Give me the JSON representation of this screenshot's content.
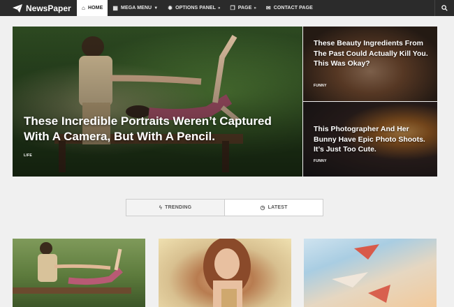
{
  "nav": {
    "brand": "NewsPaper",
    "items": [
      {
        "label": "HOME",
        "icon": "home-icon"
      },
      {
        "label": "MEGA MENU",
        "icon": "grid-icon"
      },
      {
        "label": "OPTIONS PANEL",
        "icon": "gear-icon"
      },
      {
        "label": "PAGE",
        "icon": "copy-icon"
      },
      {
        "label": "CONTACT PAGE",
        "icon": "mail-icon"
      }
    ],
    "search_icon": "search-icon"
  },
  "hero": {
    "main": {
      "title": "These Incredible Portraits Weren’t Captured With A Camera, But With A Pencil.",
      "category": "LIFE"
    },
    "side": [
      {
        "title": "These Beauty Ingredients From The Past Could Actually Kill You. This Was Okay?",
        "category": "FUNNY"
      },
      {
        "title": "This Photographer And Her Bunny Have Epic Photo Shoots. It’s Just Too Cute.",
        "category": "FUNNY"
      }
    ]
  },
  "tabs": [
    {
      "label": "TRENDING",
      "icon": "bolt-icon"
    },
    {
      "label": "LATEST",
      "icon": "clock-icon"
    }
  ]
}
